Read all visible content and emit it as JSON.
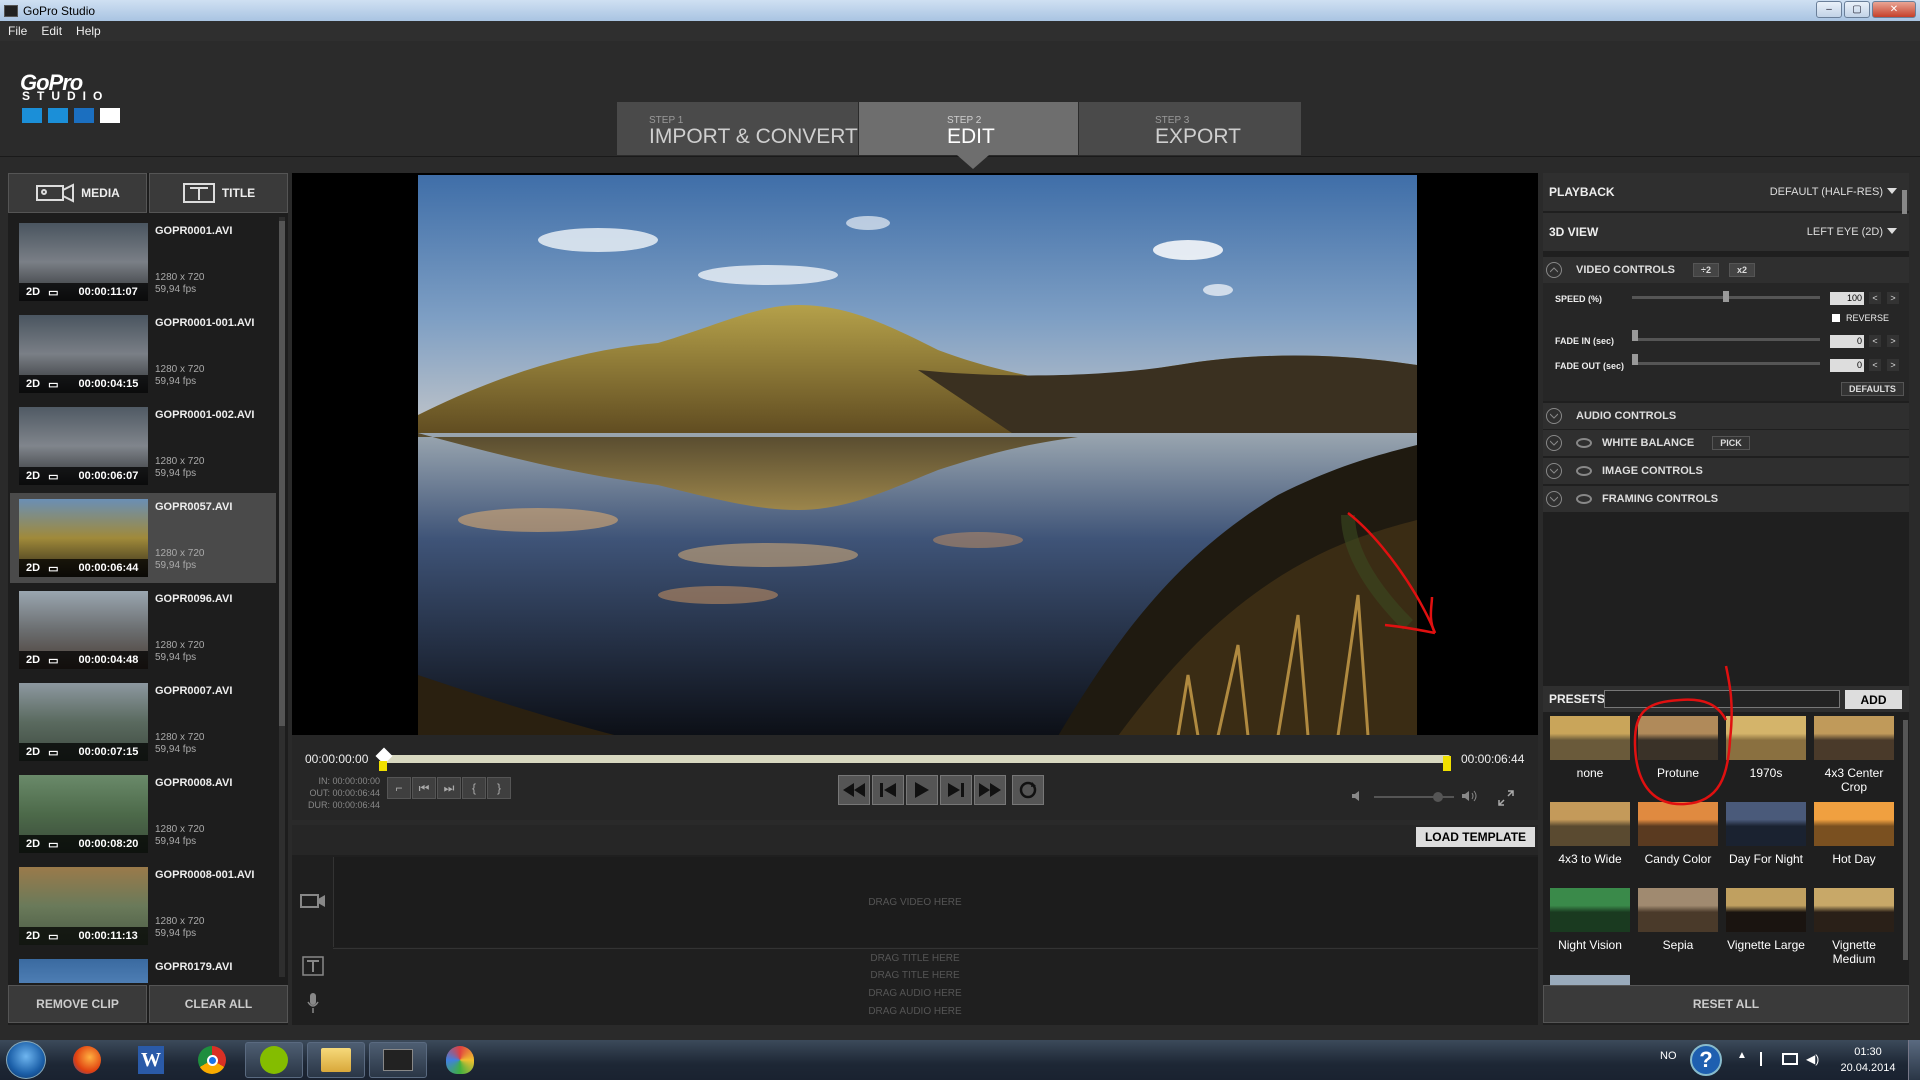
{
  "window": {
    "title": "GoPro Studio",
    "buttons": [
      "–",
      "▢",
      "✕"
    ]
  },
  "menu": [
    "File",
    "Edit",
    "Help"
  ],
  "logo": {
    "brand": "GoPro",
    "product": "STUDIO",
    "squares": [
      "#1b8fd8",
      "#1b8fd8",
      "#1b6fc0",
      "#ffffff"
    ]
  },
  "steps": [
    {
      "step": "STEP 1",
      "label": "IMPORT & CONVERT",
      "active": false
    },
    {
      "step": "STEP 2",
      "label": "EDIT",
      "active": true
    },
    {
      "step": "STEP 3",
      "label": "EXPORT",
      "active": false
    }
  ],
  "left_tabs": {
    "media": "MEDIA",
    "title": "TITLE"
  },
  "clips": [
    {
      "name": "GOPR0001.AVI",
      "res": "1280 x 720",
      "fps": "59,94 fps",
      "mode": "2D",
      "duration": "00:00:11:07",
      "selected": false,
      "thumb_colors": [
        "#4a5560",
        "#7a7f86",
        "#2b2d2f"
      ]
    },
    {
      "name": "GOPR0001-001.AVI",
      "res": "1280 x 720",
      "fps": "59,94 fps",
      "mode": "2D",
      "duration": "00:00:04:15",
      "selected": false,
      "thumb_colors": [
        "#4a5560",
        "#7a7f86",
        "#2b2d2f"
      ]
    },
    {
      "name": "GOPR0001-002.AVI",
      "res": "1280 x 720",
      "fps": "59,94 fps",
      "mode": "2D",
      "duration": "00:00:06:07",
      "selected": false,
      "thumb_colors": [
        "#505a64",
        "#80858c",
        "#2b2d2f"
      ]
    },
    {
      "name": "GOPR0057.AVI",
      "res": "1280 x 720",
      "fps": "59,94 fps",
      "mode": "2D",
      "duration": "00:00:06:44",
      "selected": true,
      "thumb_colors": [
        "#6a8fb5",
        "#a08a3a",
        "#2a2418"
      ]
    },
    {
      "name": "GOPR0096.AVI",
      "res": "1280 x 720",
      "fps": "59,94 fps",
      "mode": "2D",
      "duration": "00:00:04:48",
      "selected": false,
      "thumb_colors": [
        "#9aa6b0",
        "#6b6e70",
        "#4a3c34"
      ]
    },
    {
      "name": "GOPR0007.AVI",
      "res": "1280 x 720",
      "fps": "59,94 fps",
      "mode": "2D",
      "duration": "00:00:07:15",
      "selected": false,
      "thumb_colors": [
        "#8d98a0",
        "#5a6a5f",
        "#3e4a40"
      ]
    },
    {
      "name": "GOPR0008.AVI",
      "res": "1280 x 720",
      "fps": "59,94 fps",
      "mode": "2D",
      "duration": "00:00:08:20",
      "selected": false,
      "thumb_colors": [
        "#6a8a6a",
        "#4d6a4a",
        "#3a4a3a"
      ]
    },
    {
      "name": "GOPR0008-001.AVI",
      "res": "1280 x 720",
      "fps": "59,94 fps",
      "mode": "2D",
      "duration": "00:00:11:13",
      "selected": false,
      "thumb_colors": [
        "#9a7a4a",
        "#6a7a5a",
        "#4a5a44"
      ]
    },
    {
      "name": "GOPR0179.AVI",
      "res": "",
      "fps": "",
      "mode": "",
      "duration": "",
      "selected": false,
      "thumb_colors": [
        "#3a6aa0",
        "#5a8ac0",
        "#2a4a70"
      ]
    }
  ],
  "left_buttons": {
    "remove": "REMOVE CLIP",
    "clear": "CLEAR ALL"
  },
  "player": {
    "start_tc": "00:00:00:00",
    "end_tc": "00:00:06:44",
    "in_label": "IN: 00:00:00:00",
    "out_label": "OUT: 00:00:06:44",
    "dur_label": "DUR: 00:00:06:44",
    "playhead_fraction": 0.0,
    "volume_fraction": 0.8
  },
  "timeline": {
    "load_template": "LOAD TEMPLATE",
    "drag_video": "DRAG VIDEO HERE",
    "drag_title_1": "DRAG TITLE HERE",
    "drag_title_2": "DRAG TITLE HERE",
    "drag_audio_1": "DRAG AUDIO HERE",
    "drag_audio_2": "DRAG AUDIO HERE"
  },
  "right": {
    "playback_label": "PLAYBACK",
    "playback_value": "DEFAULT (HALF-RES)",
    "view3d_label": "3D VIEW",
    "view3d_value": "LEFT EYE (2D)",
    "video_controls": "VIDEO CONTROLS",
    "div2": "÷2",
    "x2": "x2",
    "speed_label": "SPEED (%)",
    "speed_value": "100",
    "speed_fraction": 0.5,
    "reverse": "REVERSE",
    "fade_in_label": "FADE IN (sec)",
    "fade_in_value": "0",
    "fade_out_label": "FADE OUT (sec)",
    "fade_out_value": "0",
    "defaults": "DEFAULTS",
    "audio_controls": "AUDIO CONTROLS",
    "white_balance": "WHITE BALANCE",
    "pick": "PICK",
    "image_controls": "IMAGE CONTROLS",
    "framing_controls": "FRAMING CONTROLS"
  },
  "presets": {
    "label": "PRESETS",
    "add": "ADD",
    "reset_all": "RESET ALL",
    "items": [
      {
        "name": "none",
        "colors": [
          "#c9a55a",
          "#6a5a3a"
        ]
      },
      {
        "name": "Protune",
        "colors": [
          "#b08a5a",
          "#3a3228"
        ]
      },
      {
        "name": "1970s",
        "colors": [
          "#d4b46a",
          "#8a7040"
        ]
      },
      {
        "name": "4x3 Center Crop",
        "colors": [
          "#c09a5a",
          "#4a3a2a"
        ]
      },
      {
        "name": "4x3 to Wide",
        "colors": [
          "#c49a5a",
          "#5a4a30"
        ]
      },
      {
        "name": "Candy Color",
        "colors": [
          "#e08a40",
          "#5a3a20"
        ]
      },
      {
        "name": "Day For Night",
        "colors": [
          "#4a5a7a",
          "#1a2230"
        ]
      },
      {
        "name": "Hot Day",
        "colors": [
          "#f0a040",
          "#7a5020"
        ]
      },
      {
        "name": "Night Vision",
        "colors": [
          "#3a8a4a",
          "#1a3a20"
        ]
      },
      {
        "name": "Sepia",
        "colors": [
          "#a08a70",
          "#4a3a2a"
        ]
      },
      {
        "name": "Vignette Large",
        "colors": [
          "#c0a060",
          "#1a1410"
        ]
      },
      {
        "name": "Vignette Medium",
        "colors": [
          "#c8a868",
          "#2a2018"
        ]
      }
    ]
  },
  "taskbar": {
    "apps": [
      "start-orb",
      "firefox",
      "word",
      "chrome",
      "spotify",
      "explorer",
      "gopro-studio",
      "paint"
    ],
    "lang": "NO",
    "time": "01:30",
    "date": "20.04.2014"
  },
  "annotation_color": "#e01010"
}
